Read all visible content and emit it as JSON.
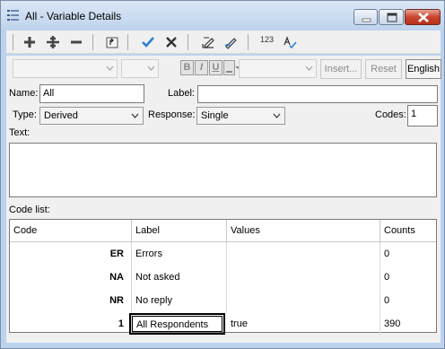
{
  "window": {
    "title": "All - Variable Details"
  },
  "toolbar1": {
    "icons": [
      "add-icon",
      "insert-icon",
      "remove-icon",
      "up-level-icon",
      "accept-icon",
      "cancel-icon",
      "edit-text-icon",
      "edit-pencil-icon",
      "numbering-icon",
      "spellcheck-icon"
    ],
    "numbering_text": "123"
  },
  "toolbar2": {
    "bold": "B",
    "italic": "I",
    "underline": "U",
    "insert_label": "Insert...",
    "reset_label": "Reset",
    "language_label": "English"
  },
  "form": {
    "name_label": "Name:",
    "name_value": "All",
    "label_label": "Label:",
    "label_value": "",
    "type_label": "Type:",
    "type_value": "Derived",
    "response_label": "Response:",
    "response_value": "Single",
    "codes_label": "Codes:",
    "codes_value": "1",
    "text_label": "Text:",
    "code_list_label": "Code list:"
  },
  "table": {
    "columns": [
      "Code",
      "Label",
      "Values",
      "Counts"
    ],
    "rows": [
      {
        "code": "ER",
        "label": "Errors",
        "values": "",
        "counts": "0"
      },
      {
        "code": "NA",
        "label": "Not asked",
        "values": "",
        "counts": "0"
      },
      {
        "code": "NR",
        "label": "No reply",
        "values": "",
        "counts": "0"
      },
      {
        "code": "1",
        "label": "All Respondents",
        "values": "true",
        "counts": "390"
      }
    ]
  }
}
